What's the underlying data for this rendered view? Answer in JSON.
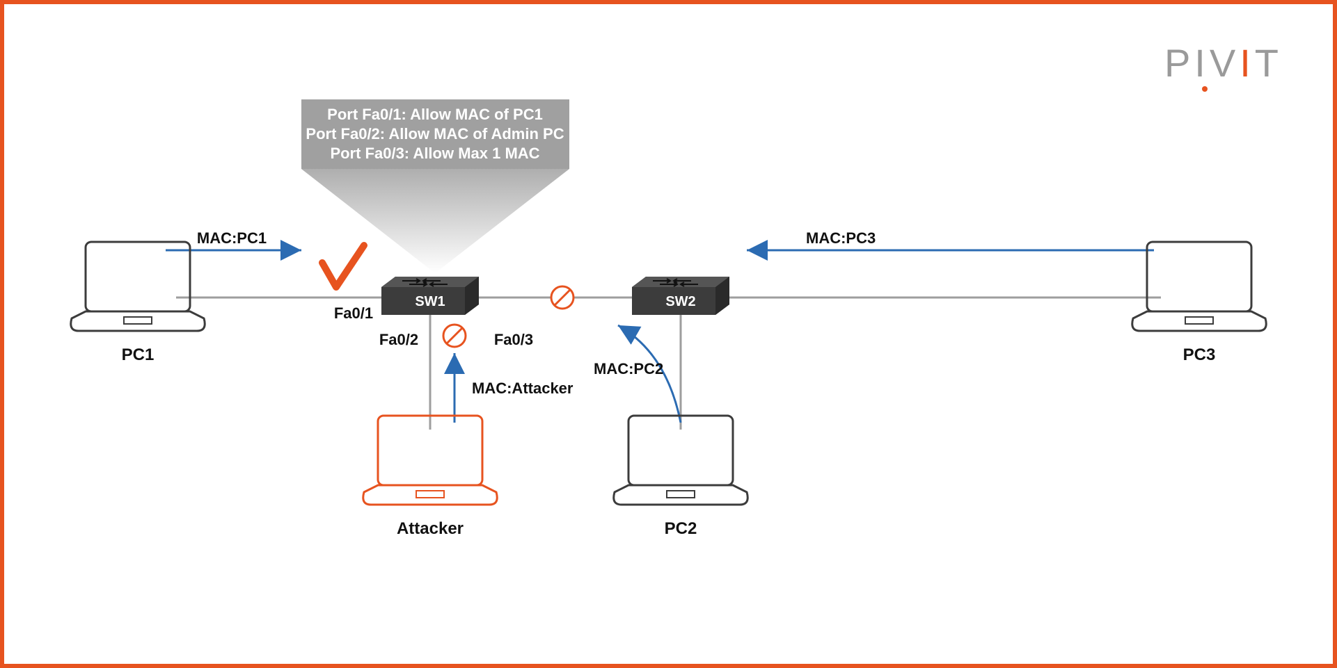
{
  "brand": {
    "pre": "PIV",
    "accent": "I",
    "post": "T"
  },
  "rules": {
    "line1": "Port Fa0/1: Allow MAC of PC1",
    "line2": "Port Fa0/2: Allow MAC of Admin PC",
    "line3": "Port Fa0/3: Allow Max 1 MAC"
  },
  "nodes": {
    "pc1": "PC1",
    "pc2": "PC2",
    "pc3": "PC3",
    "attacker": "Attacker",
    "sw1": "SW1",
    "sw2": "SW2"
  },
  "ports": {
    "fa01": "Fa0/1",
    "fa02": "Fa0/2",
    "fa03": "Fa0/3"
  },
  "flows": {
    "pc1": "MAC:PC1",
    "pc2": "MAC:PC2",
    "pc3": "MAC:PC3",
    "attacker": "MAC:Attacker"
  },
  "colors": {
    "orange": "#e7531f",
    "gray": "#9a9a9a",
    "dark": "#3c3c3c",
    "blue": "#2b6bb2",
    "boxgray": "#a0a0a0",
    "line": "#9e9e9e"
  }
}
